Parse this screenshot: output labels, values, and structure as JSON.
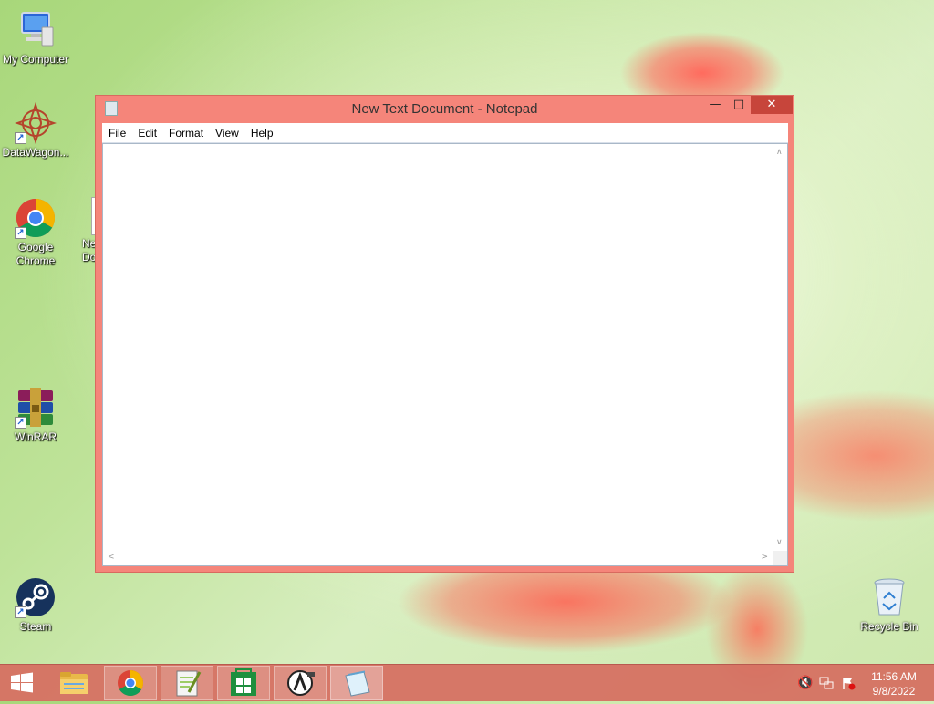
{
  "desktop": {
    "icons": [
      {
        "label": "My Computer"
      },
      {
        "label": "DataWagon..."
      },
      {
        "label": "Google\nChrome"
      },
      {
        "label": "WinRAR"
      },
      {
        "label": "Steam"
      },
      {
        "label": "Recycle Bin"
      }
    ],
    "partial_icon_label": "Ne\nDo"
  },
  "notepad": {
    "title": "New Text Document - Notepad",
    "menu": [
      "File",
      "Edit",
      "Format",
      "View",
      "Help"
    ],
    "content": ""
  },
  "taskbar": {
    "clock_time": "11:56 AM",
    "clock_date": "9/8/2022",
    "pinned": [
      "start",
      "file-explorer",
      "google-chrome",
      "notepad-plus-plus",
      "windows-store",
      "steam-game",
      "notepad"
    ]
  },
  "colors": {
    "window_frame": "#f5857a",
    "close_button": "#c7453b",
    "taskbar": "#d66c60"
  }
}
